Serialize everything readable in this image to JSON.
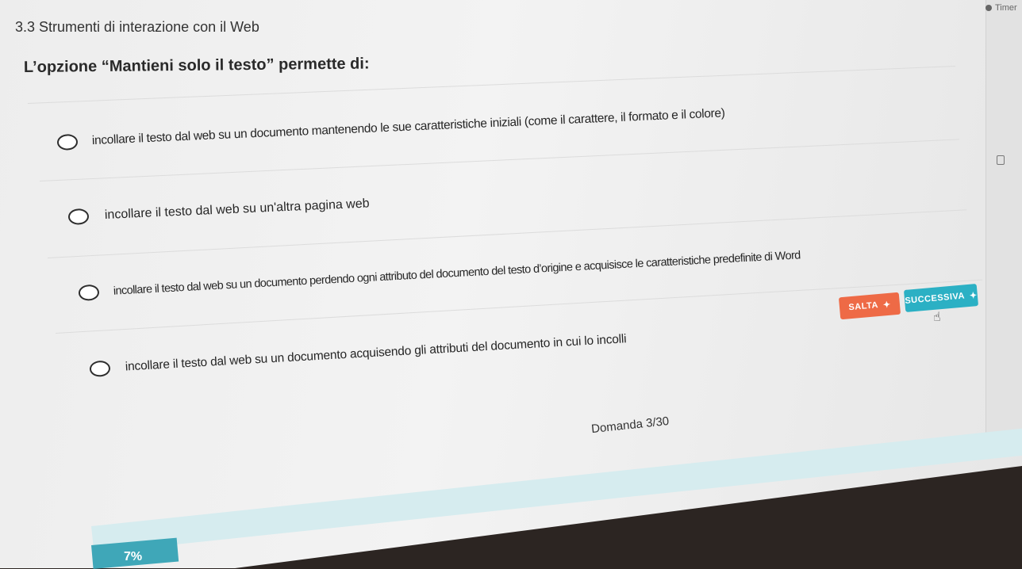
{
  "header": {
    "section_title": "3.3 Strumenti di interazione con il Web",
    "timer_label": "Timer"
  },
  "question": {
    "text": "L’opzione “Mantieni solo il testo” permette di:"
  },
  "options": [
    {
      "label": "incollare il testo dal web su un documento mantenendo le sue caratteristiche iniziali (come il carattere, il formato e il colore)"
    },
    {
      "label": "incollare il testo dal web su un'altra pagina web"
    },
    {
      "label": "incollare il testo dal web su un documento perdendo ogni attributo del documento del testo d’origine e acquisisce le caratteristiche predefinite di Word"
    },
    {
      "label": "incollare il testo dal web su un documento acquisendo gli attributi del documento in cui lo incolli"
    }
  ],
  "buttons": {
    "skip_label": "SALTA",
    "next_label": "SUCCESSIVA"
  },
  "footer": {
    "counter": "Domanda 3/30",
    "progress_text": "7%",
    "progress_value": 0.07
  },
  "colors": {
    "skip": "#ee6a46",
    "next": "#2bb0c4",
    "progress": "#3fa7b8"
  }
}
